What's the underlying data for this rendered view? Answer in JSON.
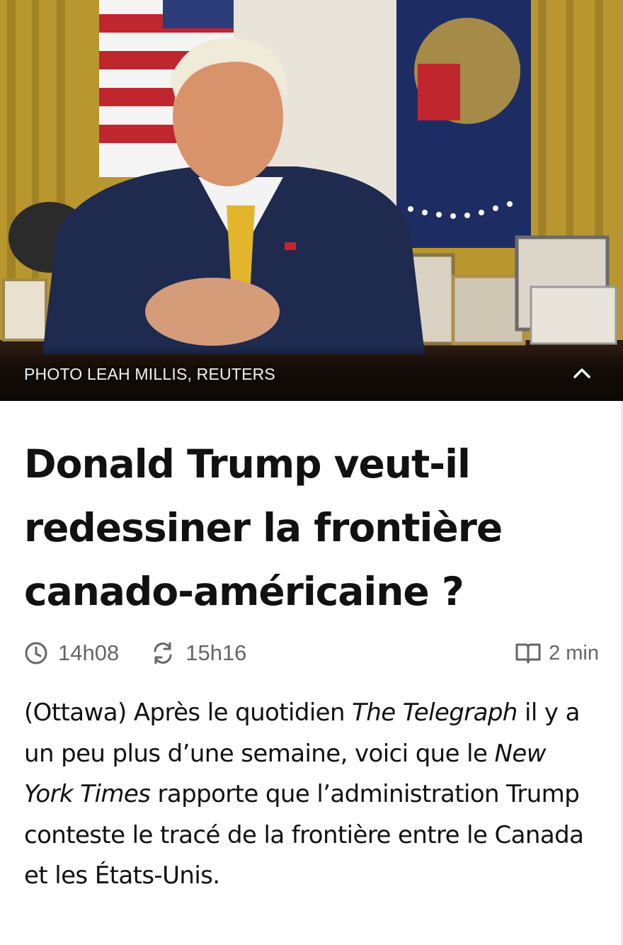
{
  "photo": {
    "credit": "PHOTO LEAH MILLIS, REUTERS",
    "collapse_icon": "chevron-up-icon"
  },
  "article": {
    "headline": "Donald Trump veut-il redessiner la frontière canado-américaine ?",
    "published_time": "14h08",
    "updated_time": "15h16",
    "reading_time": "2 min",
    "lead": {
      "prefix": "(Ottawa) Après le quotidien ",
      "source1": "The Telegraph",
      "middle": " il y a un peu plus d’une semaine, voici que le ",
      "source2": "New York Times",
      "suffix": " rapporte que l’administration Trump conteste le tracé de la frontière entre le Canada et les États-Unis."
    }
  },
  "icons": {
    "published": "clock-icon",
    "updated": "refresh-icon",
    "reading": "book-icon"
  },
  "colors": {
    "meta_text": "#666666",
    "headline": "#111111",
    "caption_text": "#f2f2f2"
  }
}
